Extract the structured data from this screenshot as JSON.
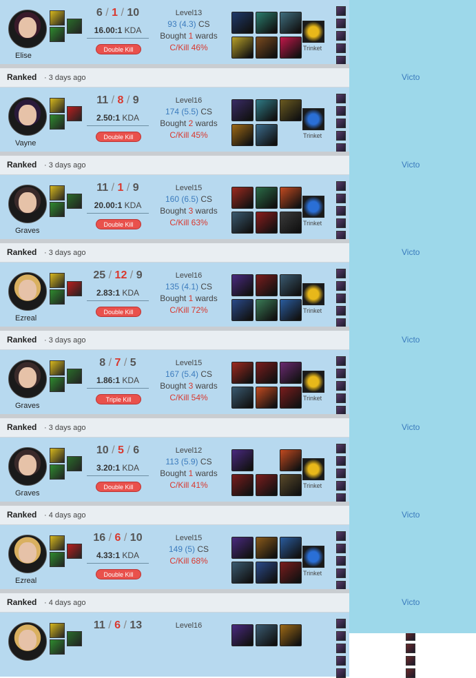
{
  "games": [
    {
      "queue": "",
      "date": "",
      "champion": "Elise",
      "kills": 6,
      "deaths": 1,
      "assists": 10,
      "kda": "16.00:1",
      "multikill": "Double Kill",
      "level": "Level13",
      "cs": "93",
      "cs_per_min": "(4.3)",
      "wards": "1",
      "ckill": "C/Kill 46%",
      "trinket": "Trinket",
      "result": ""
    },
    {
      "queue": "Ranked",
      "date": "3 days ago",
      "champion": "Vayne",
      "kills": 11,
      "deaths": 8,
      "assists": 9,
      "kda": "2.50:1",
      "multikill": "Double Kill",
      "level": "Level16",
      "cs": "174",
      "cs_per_min": "(5.5)",
      "wards": "2",
      "ckill": "C/Kill 45%",
      "trinket": "Trinket",
      "result": "Victo"
    },
    {
      "queue": "Ranked",
      "date": "3 days ago",
      "champion": "Graves",
      "kills": 11,
      "deaths": 1,
      "assists": 9,
      "kda": "20.00:1",
      "multikill": "Double Kill",
      "level": "Level15",
      "cs": "160",
      "cs_per_min": "(6.5)",
      "wards": "3",
      "ckill": "C/Kill 63%",
      "trinket": "Trinket",
      "result": "Victo"
    },
    {
      "queue": "Ranked",
      "date": "3 days ago",
      "champion": "Ezreal",
      "kills": 25,
      "deaths": 12,
      "assists": 9,
      "kda": "2.83:1",
      "multikill": "Double Kill",
      "level": "Level16",
      "cs": "135",
      "cs_per_min": "(4.1)",
      "wards": "1",
      "ckill": "C/Kill 72%",
      "trinket": "Trinket",
      "result": "Victo"
    },
    {
      "queue": "Ranked",
      "date": "3 days ago",
      "champion": "Graves",
      "kills": 8,
      "deaths": 7,
      "assists": 5,
      "kda": "1.86:1",
      "multikill": "Triple Kill",
      "level": "Level15",
      "cs": "167",
      "cs_per_min": "(5.4)",
      "wards": "3",
      "ckill": "C/Kill 54%",
      "trinket": "Trinket",
      "result": "Victo"
    },
    {
      "queue": "Ranked",
      "date": "3 days ago",
      "champion": "Graves",
      "kills": 10,
      "deaths": 5,
      "assists": 6,
      "kda": "3.20:1",
      "multikill": "Double Kill",
      "level": "Level12",
      "cs": "113",
      "cs_per_min": "(5.9)",
      "wards": "1",
      "ckill": "C/Kill 41%",
      "trinket": "Trinket",
      "result": "Victo"
    },
    {
      "queue": "Ranked",
      "date": "4 days ago",
      "champion": "Ezreal",
      "kills": 16,
      "deaths": 6,
      "assists": 10,
      "kda": "4.33:1",
      "multikill": "Double Kill",
      "level": "Level15",
      "cs": "149",
      "cs_per_min": "(5)",
      "wards": "",
      "ckill": "C/Kill 68%",
      "trinket": "Trinket",
      "result": "Victo"
    },
    {
      "queue": "Ranked",
      "date": "4 days ago",
      "champion": "",
      "kills": 11,
      "deaths": 6,
      "assists": 13,
      "kda": "",
      "multikill": "",
      "level": "Level16",
      "cs": "",
      "cs_per_min": "",
      "wards": "",
      "ckill": "",
      "trinket": "",
      "result": "Victo"
    }
  ],
  "labels": {
    "cs_suffix": " CS",
    "bought": "Bought ",
    "wards_suffix": " wards",
    "kda_suffix": " KDA",
    "slash": " / ",
    "dot": " · "
  },
  "colors": {
    "row_bg": "#b7d9ef",
    "side_bg": "#9dd8ea",
    "header_bg": "#e9eef2",
    "deaths": "#d9382e",
    "cs_blue": "#3b7bbd",
    "badge": "#e9514c"
  },
  "icons": {
    "spells": [
      "flash-spell-icon",
      "smite-spell-icon"
    ],
    "items": [
      "bladed-item-icon",
      "potion-item-icon",
      "boots-item-icon",
      "tome-item-icon",
      "crystal-item-icon"
    ],
    "trinkets": [
      "sun-trinket-icon",
      "blue-orb-trinket-icon"
    ]
  }
}
